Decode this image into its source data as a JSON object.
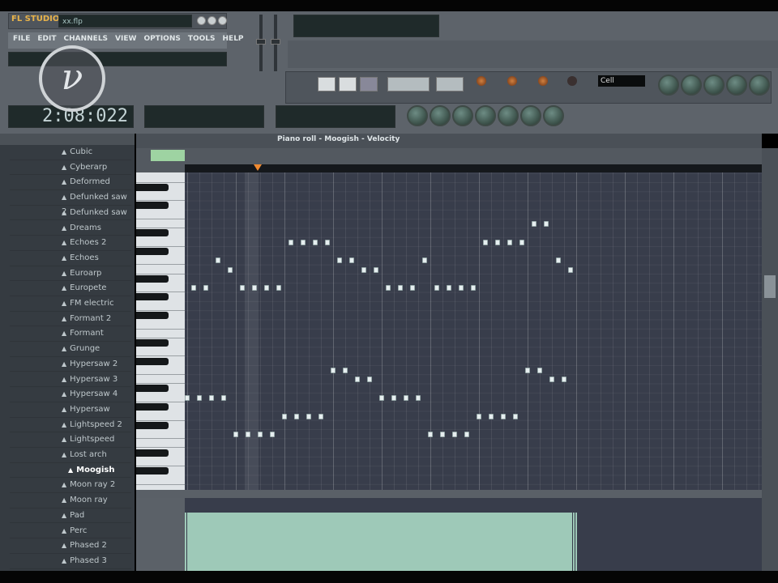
{
  "app": {
    "logo": "FL STUDIO",
    "file": "xx.flp",
    "menu": [
      "FILE",
      "EDIT",
      "CHANNELS",
      "VIEW",
      "OPTIONS",
      "TOOLS",
      "HELP"
    ],
    "time": "2:08:022",
    "snap": "Cell"
  },
  "piano_roll": {
    "title": "Piano roll - Moogish - Velocity"
  },
  "browser": {
    "items": [
      "Cubic",
      "Cyberarp",
      "Deformed",
      "Defunked saw 2",
      "Defunked saw",
      "Dreams",
      "Echoes 2",
      "Echoes",
      "Euroarp",
      "Europete",
      "FM electric",
      "Formant 2",
      "Formant",
      "Grunge",
      "Hypersaw 2",
      "Hypersaw 3",
      "Hypersaw 4",
      "Hypersaw",
      "Lightspeed 2",
      "Lightspeed",
      "Lost arch",
      "Moogish",
      "Moon ray 2",
      "Moon ray",
      "Pad",
      "Perc",
      "Phased 2",
      "Phased 3"
    ],
    "selected": "Moogish"
  },
  "colors": {
    "accent": "#9ed3a2",
    "playhead": "#f08a30",
    "note": "#e6eef0"
  },
  "notes_unit": "step = 1/16 note, pitch = MIDI",
  "notes": [
    [
      0,
      69
    ],
    [
      1,
      69
    ],
    [
      2,
      72
    ],
    [
      3,
      71
    ],
    [
      4,
      69
    ],
    [
      5,
      69
    ],
    [
      6,
      69
    ],
    [
      7,
      69
    ],
    [
      8,
      74
    ],
    [
      9,
      74
    ],
    [
      10,
      74
    ],
    [
      11,
      74
    ],
    [
      12,
      72
    ],
    [
      13,
      72
    ],
    [
      14,
      71
    ],
    [
      15,
      71
    ],
    [
      16,
      69
    ],
    [
      17,
      69
    ],
    [
      18,
      69
    ],
    [
      19,
      72
    ],
    [
      20,
      69
    ],
    [
      21,
      69
    ],
    [
      22,
      69
    ],
    [
      23,
      69
    ],
    [
      24,
      74
    ],
    [
      25,
      74
    ],
    [
      26,
      74
    ],
    [
      27,
      74
    ],
    [
      28,
      76
    ],
    [
      29,
      76
    ],
    [
      30,
      72
    ],
    [
      31,
      71
    ],
    [
      -0.5,
      57
    ],
    [
      0.5,
      57
    ],
    [
      1.5,
      57
    ],
    [
      2.5,
      57
    ],
    [
      3.5,
      53
    ],
    [
      4.5,
      53
    ],
    [
      5.5,
      53
    ],
    [
      6.5,
      53
    ],
    [
      7.5,
      55
    ],
    [
      8.5,
      55
    ],
    [
      9.5,
      55
    ],
    [
      10.5,
      55
    ],
    [
      11.5,
      60
    ],
    [
      12.5,
      60
    ],
    [
      13.5,
      59
    ],
    [
      14.5,
      59
    ],
    [
      15.5,
      57
    ],
    [
      16.5,
      57
    ],
    [
      17.5,
      57
    ],
    [
      18.5,
      57
    ],
    [
      19.5,
      53
    ],
    [
      20.5,
      53
    ],
    [
      21.5,
      53
    ],
    [
      22.5,
      53
    ],
    [
      23.5,
      55
    ],
    [
      24.5,
      55
    ],
    [
      25.5,
      55
    ],
    [
      26.5,
      55
    ],
    [
      27.5,
      60
    ],
    [
      28.5,
      60
    ],
    [
      29.5,
      59
    ],
    [
      30.5,
      59
    ]
  ]
}
